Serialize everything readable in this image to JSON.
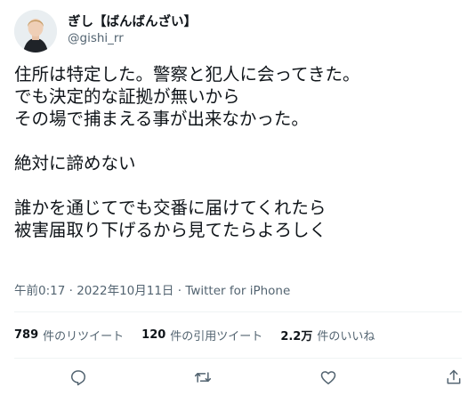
{
  "tweet": {
    "author": {
      "display_name": "ぎし【ばんばんざい】",
      "handle": "@gishi_rr"
    },
    "text_lines": [
      "住所は特定した。警察と犯人に会ってきた。",
      "でも決定的な証拠が無いから",
      "その場で捕まえる事が出来なかった。",
      "",
      "絶対に諦めない",
      "",
      "誰かを通じてでも交番に届けてくれたら",
      "被害届取り下げるから見てたらよろしく"
    ],
    "meta": {
      "time": "午前0:17",
      "separator": "·",
      "date": "2022年10月11日",
      "source": "Twitter for iPhone"
    },
    "stats": {
      "retweets_count": "789",
      "retweets_label": "件のリツイート",
      "quotes_count": "120",
      "quotes_label": "件の引用ツイート",
      "likes_count": "2.2万",
      "likes_label": "件のいいね"
    },
    "actions": [
      "reply-icon",
      "retweet-icon",
      "like-icon",
      "share-icon"
    ]
  },
  "colors": {
    "text_primary": "#0f1419",
    "text_secondary": "#536471",
    "divider": "#eff3f4"
  }
}
